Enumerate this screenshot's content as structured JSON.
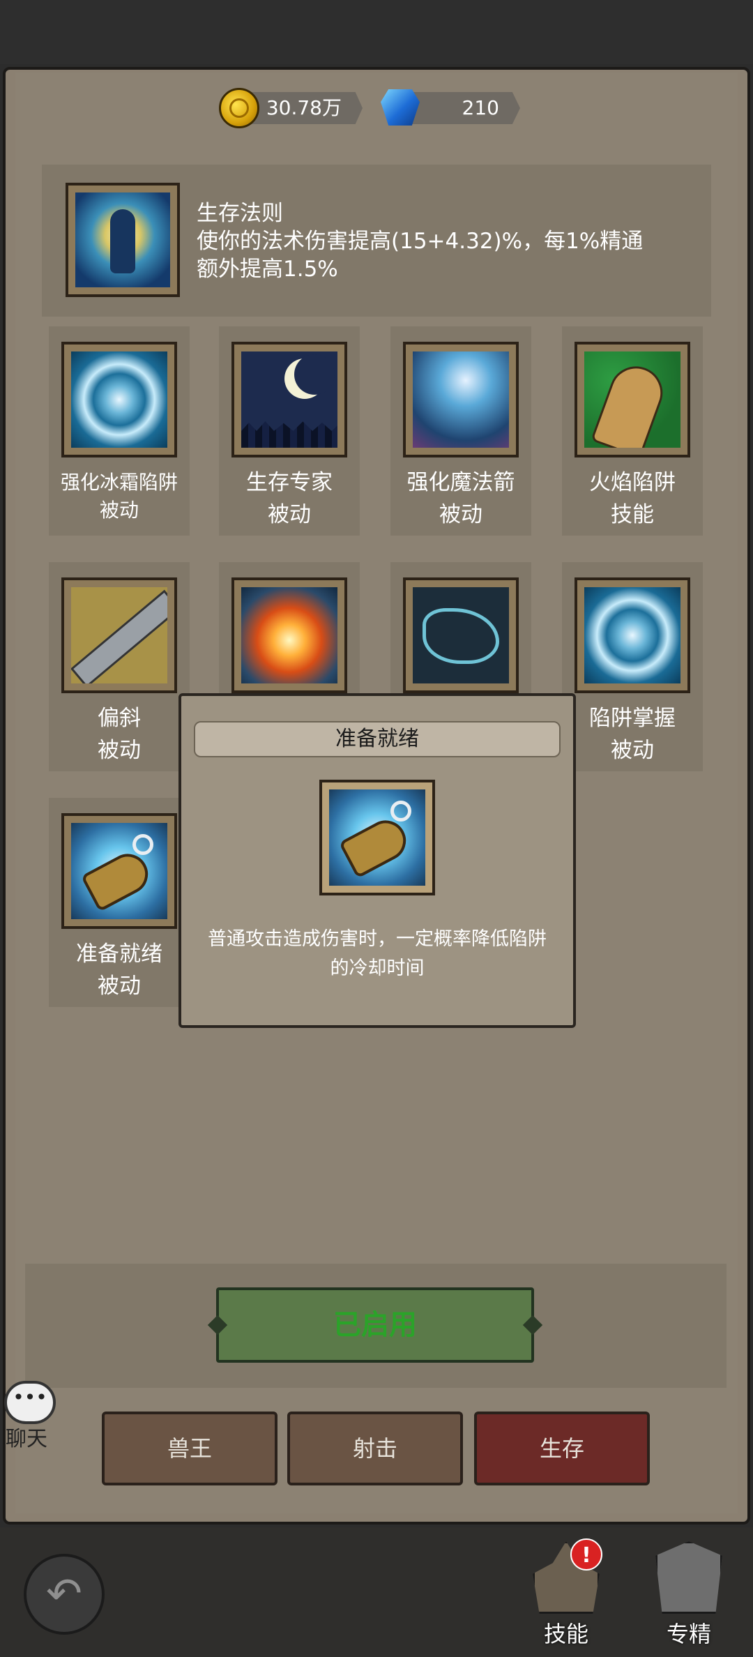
{
  "currency": {
    "gold": "30.78万",
    "gems": "210"
  },
  "header": {
    "skill_name": "生存法则",
    "description": "使你的法术伤害提高(15+4.32)%，每1%精通\n额外提高1.5%"
  },
  "skills": [
    {
      "name": "强化冰霜陷阱",
      "type": "被动",
      "icon": "frost-vortex-icon"
    },
    {
      "name": "生存专家",
      "type": "被动",
      "icon": "moon-night-icon"
    },
    {
      "name": "强化魔法箭",
      "type": "被动",
      "icon": "magic-arrow-icon"
    },
    {
      "name": "火焰陷阱",
      "type": "技能",
      "icon": "hand-icon"
    },
    {
      "name": "偏斜",
      "type": "被动",
      "icon": "sword-icon"
    },
    {
      "name": "",
      "type": "",
      "icon": "blast-icon"
    },
    {
      "name": "",
      "type": "",
      "icon": "beast-icon"
    },
    {
      "name": "陷阱掌握",
      "type": "被动",
      "icon": "frost-vortex-icon"
    },
    {
      "name": "准备就绪",
      "type": "被动",
      "icon": "whistle-icon"
    }
  ],
  "popup": {
    "title": "准备就绪",
    "description": "普通攻击造成伤害时，一定概率降低陷阱\n的冷却时间",
    "icon": "whistle-icon"
  },
  "enable_button": "已启用",
  "tabs": [
    "兽王",
    "射击",
    "生存"
  ],
  "chat": {
    "bubble": "•••",
    "label": "聊天"
  },
  "bottom_nav": {
    "back_icon": "back-arrow-icon",
    "skills_label": "技能",
    "skills_alert": "!",
    "spec_label": "专精"
  },
  "colors": {
    "panel": "#8c8273",
    "enabled_text": "#2ba329",
    "active_tab": "#6c2a27",
    "tab": "#6a5444"
  }
}
